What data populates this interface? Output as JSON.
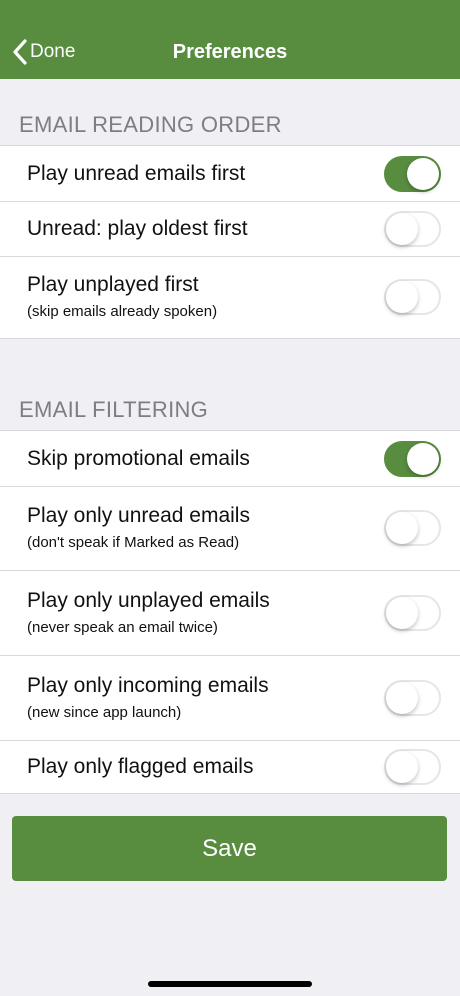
{
  "navbar": {
    "back_label": "Done",
    "title": "Preferences",
    "back_icon": "chevron-left-icon"
  },
  "sections": [
    {
      "header": "EMAIL READING ORDER",
      "rows": [
        {
          "label": "Play unread emails first",
          "sub": "",
          "on": true
        },
        {
          "label": "Unread: play oldest first",
          "sub": "",
          "on": false
        },
        {
          "label": "Play unplayed first",
          "sub": "(skip emails already spoken)",
          "on": false
        }
      ]
    },
    {
      "header": "EMAIL FILTERING",
      "rows": [
        {
          "label": "Skip promotional emails",
          "sub": "",
          "on": true
        },
        {
          "label": "Play only unread emails",
          "sub": "(don't speak if Marked as Read)",
          "on": false
        },
        {
          "label": "Play only unplayed emails",
          "sub": "(never speak an email twice)",
          "on": false
        },
        {
          "label": "Play only incoming emails",
          "sub": "(new since app launch)",
          "on": false
        },
        {
          "label": "Play only flagged emails",
          "sub": "",
          "on": false
        }
      ]
    }
  ],
  "save_label": "Save",
  "colors": {
    "accent": "#588c3f",
    "background": "#efeff4",
    "header_text": "#7d7d82"
  }
}
